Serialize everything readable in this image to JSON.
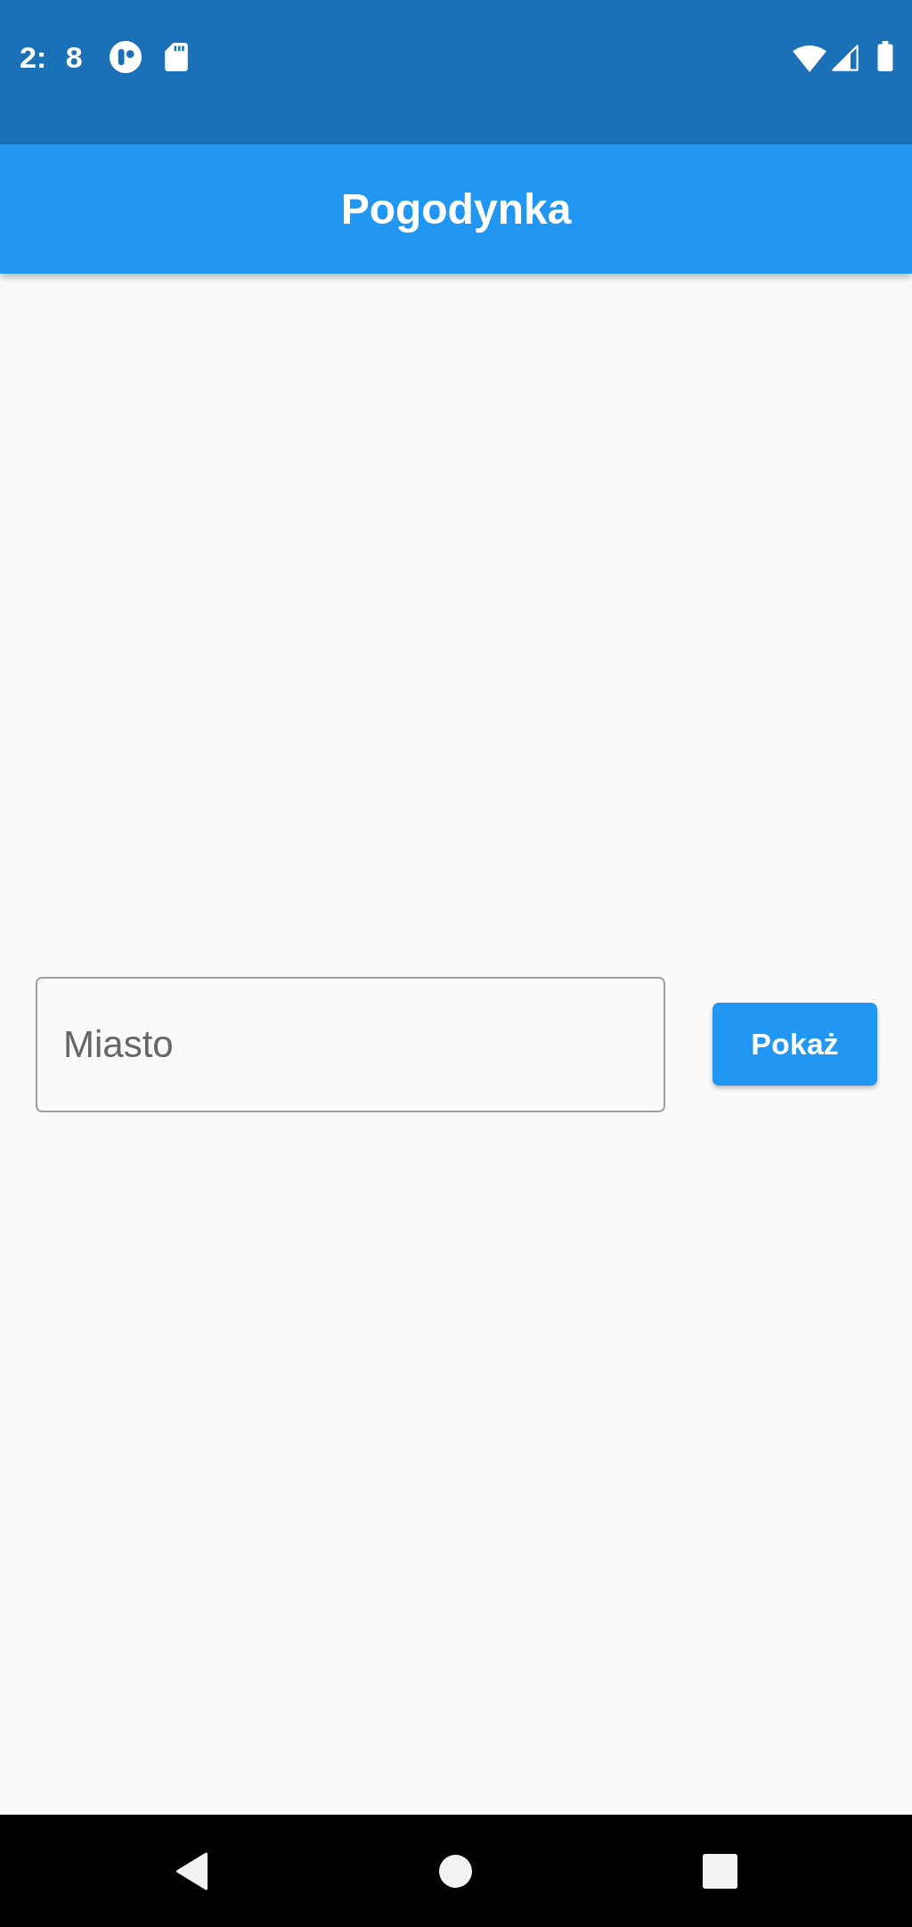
{
  "status_bar": {
    "time": "2: 8"
  },
  "app_bar": {
    "title": "Pogodynka"
  },
  "form": {
    "city_field": {
      "placeholder": "Miasto"
    },
    "submit_button": {
      "label": "Pokaż"
    }
  }
}
